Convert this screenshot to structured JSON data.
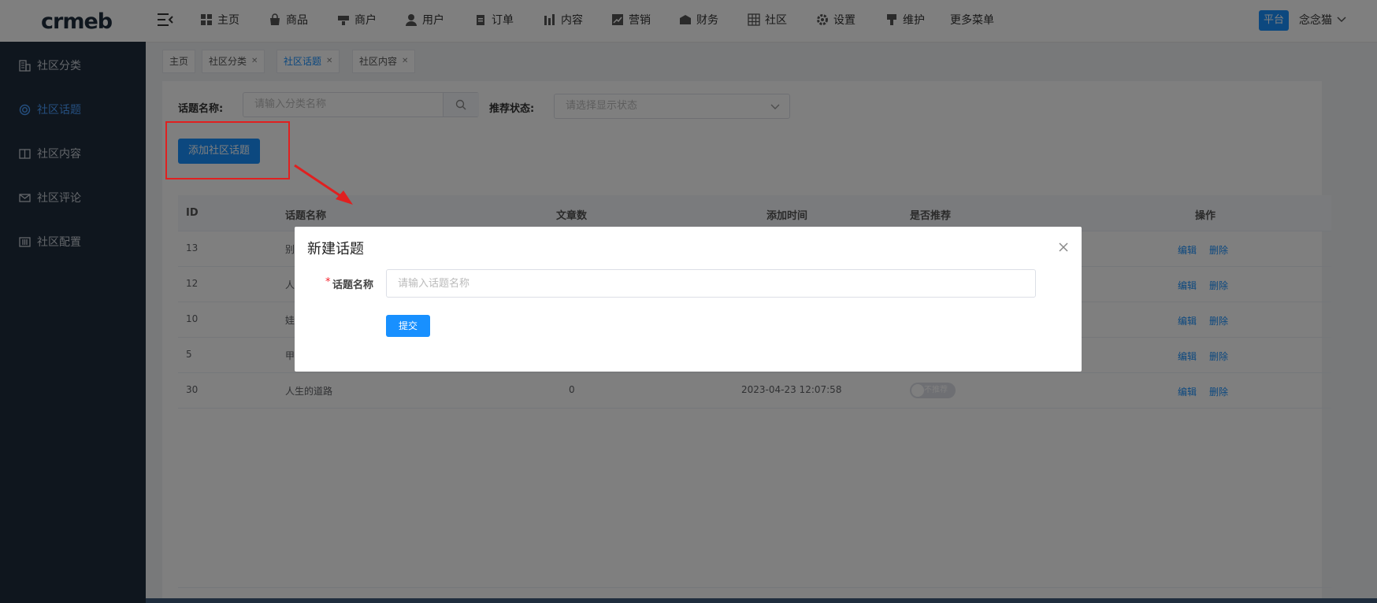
{
  "topnav": {
    "logo": "crmeb",
    "items": [
      {
        "label": "主页",
        "icon": "home-icon"
      },
      {
        "label": "商品",
        "icon": "bag-icon"
      },
      {
        "label": "商户",
        "icon": "store-icon"
      },
      {
        "label": "用户",
        "icon": "user-icon"
      },
      {
        "label": "订单",
        "icon": "clipboard-icon"
      },
      {
        "label": "内容",
        "icon": "chart-bars-icon"
      },
      {
        "label": "营销",
        "icon": "trend-icon"
      },
      {
        "label": "财务",
        "icon": "wallet-icon"
      },
      {
        "label": "社区",
        "icon": "grid-icon"
      },
      {
        "label": "设置",
        "icon": "gear-icon"
      },
      {
        "label": "维护",
        "icon": "wrench-icon"
      },
      {
        "label": "更多菜单",
        "icon": ""
      }
    ],
    "platform_badge": "平台",
    "user_name": "念念猫"
  },
  "sidebar": {
    "items": [
      {
        "label": "社区分类",
        "icon": "building-icon",
        "active": false
      },
      {
        "label": "社区话题",
        "icon": "lifebuoy-icon",
        "active": true
      },
      {
        "label": "社区内容",
        "icon": "book-icon",
        "active": false
      },
      {
        "label": "社区评论",
        "icon": "mail-icon",
        "active": false
      },
      {
        "label": "社区配置",
        "icon": "sliders-icon",
        "active": false
      }
    ]
  },
  "tags": [
    {
      "label": "主页",
      "closable": false,
      "active": false
    },
    {
      "label": "社区分类",
      "closable": true,
      "active": false
    },
    {
      "label": "社区话题",
      "closable": true,
      "active": true
    },
    {
      "label": "社区内容",
      "closable": true,
      "active": false
    }
  ],
  "filters": {
    "topic_name_label": "话题名称:",
    "topic_name_placeholder": "请输入分类名称",
    "recommend_label": "推荐状态:",
    "recommend_placeholder": "请选择显示状态"
  },
  "add_button": "添加社区话题",
  "table": {
    "headers": [
      "ID",
      "话题名称",
      "文章数",
      "添加时间",
      "是否推荐",
      "操作"
    ],
    "rows": [
      {
        "id": "13",
        "name": "别",
        "count": "",
        "time": "",
        "recommend": ""
      },
      {
        "id": "12",
        "name": "人",
        "count": "",
        "time": "",
        "recommend": ""
      },
      {
        "id": "10",
        "name": "娃",
        "count": "",
        "time": "",
        "recommend": ""
      },
      {
        "id": "5",
        "name": "甲",
        "count": "",
        "time": "",
        "recommend": ""
      },
      {
        "id": "30",
        "name": "人生的道路",
        "count": "0",
        "time": "2023-04-23 12:07:58",
        "recommend": "不推荐"
      }
    ],
    "edit_label": "编辑",
    "delete_label": "删除"
  },
  "dialog": {
    "title": "新建话题",
    "required_mark": "*",
    "field_label": "话题名称",
    "field_placeholder": "请输入话题名称",
    "field_value": "",
    "submit_label": "提交"
  },
  "colors": {
    "accent": "#1890ff",
    "sidebar_bg": "#1f2d3d",
    "highlight": "#e02020"
  }
}
